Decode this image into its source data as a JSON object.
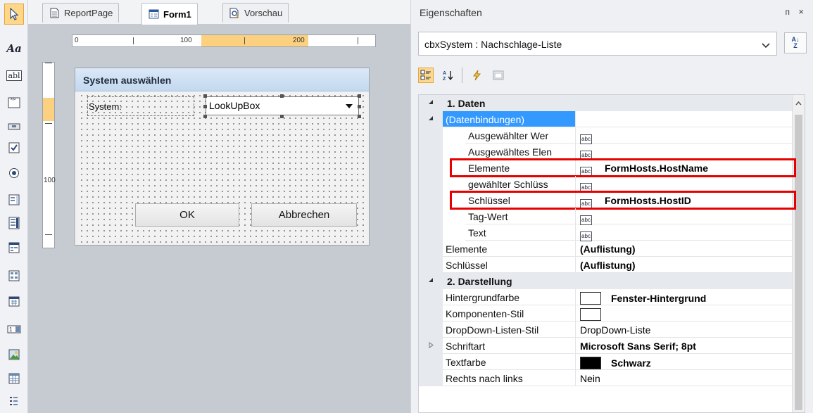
{
  "designer": {
    "tabs": [
      {
        "label": "ReportPage",
        "icon": "page-icon"
      },
      {
        "label": "Form1",
        "icon": "form-icon"
      },
      {
        "label": "Vorschau",
        "icon": "preview-icon"
      }
    ],
    "ruler_h_labels": [
      "0",
      "100",
      "200"
    ],
    "ruler_v_labels": [
      "100"
    ],
    "form": {
      "title": "System auswählen",
      "label_system": "System:",
      "lookup_value": "LookUpBox",
      "ok_button": "OK",
      "cancel_button": "Abbrechen"
    }
  },
  "toolbox": {
    "items": [
      "pointer-icon",
      "label-tool-icon",
      "textbox-tool-icon",
      "groupbox-tool-icon",
      "button-tool-icon",
      "checkbox-tool-icon",
      "radiobutton-tool-icon",
      "listbox-tool-icon",
      "combobox-tool-icon",
      "checkedlist-tool-icon",
      "treeview-tool-icon",
      "calendar-tool-icon",
      "numericupdown-tool-icon",
      "picturebox-tool-icon",
      "grid-tool-icon",
      "list-tool-icon"
    ],
    "label_tool_text": "Aa",
    "textbox_tool_text": "abl"
  },
  "properties": {
    "title": "Eigenschaften",
    "pin_glyph": "ᴨ",
    "close_glyph": "×",
    "object_selector": "cbxSystem : Nachschlage-Liste",
    "sort_glyph": "A↓Z",
    "abc_glyph": "abc",
    "rows": [
      {
        "kind": "cat",
        "name": "1. Daten"
      },
      {
        "kind": "sub",
        "name": "(Datenbindungen)",
        "selected": true
      },
      {
        "kind": "prop",
        "indent": 2,
        "name": "Ausgewählter Wer",
        "value": "",
        "abc": true
      },
      {
        "kind": "prop",
        "indent": 2,
        "name": "Ausgewähltes Elen",
        "value": "",
        "abc": true
      },
      {
        "kind": "prop",
        "indent": 2,
        "name": "Elemente",
        "value": "FormHosts.HostName",
        "abc": true,
        "bold": true,
        "highlight": true
      },
      {
        "kind": "prop",
        "indent": 2,
        "name": "gewählter Schlüss",
        "value": "",
        "abc": true
      },
      {
        "kind": "prop",
        "indent": 2,
        "name": "Schlüssel",
        "value": "FormHosts.HostID",
        "abc": true,
        "bold": true,
        "highlight": true
      },
      {
        "kind": "prop",
        "indent": 2,
        "name": "Tag-Wert",
        "value": "",
        "abc": true
      },
      {
        "kind": "prop",
        "indent": 2,
        "name": "Text",
        "value": "",
        "abc": true
      },
      {
        "kind": "prop",
        "indent": 1,
        "name": "Elemente",
        "value": "(Auflistung)",
        "bold": true
      },
      {
        "kind": "prop",
        "indent": 1,
        "name": "Schlüssel",
        "value": "(Auflistung)",
        "bold": true
      },
      {
        "kind": "cat",
        "name": "2. Darstellung"
      },
      {
        "kind": "prop",
        "indent": 1,
        "name": "Hintergrundfarbe",
        "value": "Fenster-Hintergrund",
        "bold": true,
        "swatch": "#ffffff"
      },
      {
        "kind": "prop",
        "indent": 1,
        "name": "Komponenten-Stil",
        "value": "",
        "swatch": "#ffffff"
      },
      {
        "kind": "prop",
        "indent": 1,
        "name": "DropDown-Listen-Stil",
        "value": "DropDown-Liste"
      },
      {
        "kind": "prop",
        "indent": 1,
        "name": "Schriftart",
        "value": "Microsoft Sans Serif; 8pt",
        "bold": true,
        "expander": true
      },
      {
        "kind": "prop",
        "indent": 1,
        "name": "Textfarbe",
        "value": "Schwarz",
        "bold": true,
        "swatch": "#000000"
      },
      {
        "kind": "prop",
        "indent": 1,
        "name": "Rechts nach links",
        "value": "Nein"
      }
    ]
  },
  "colors": {
    "accent": "#fbd07e",
    "selection": "#3399ff",
    "highlight_border": "#e60000"
  }
}
